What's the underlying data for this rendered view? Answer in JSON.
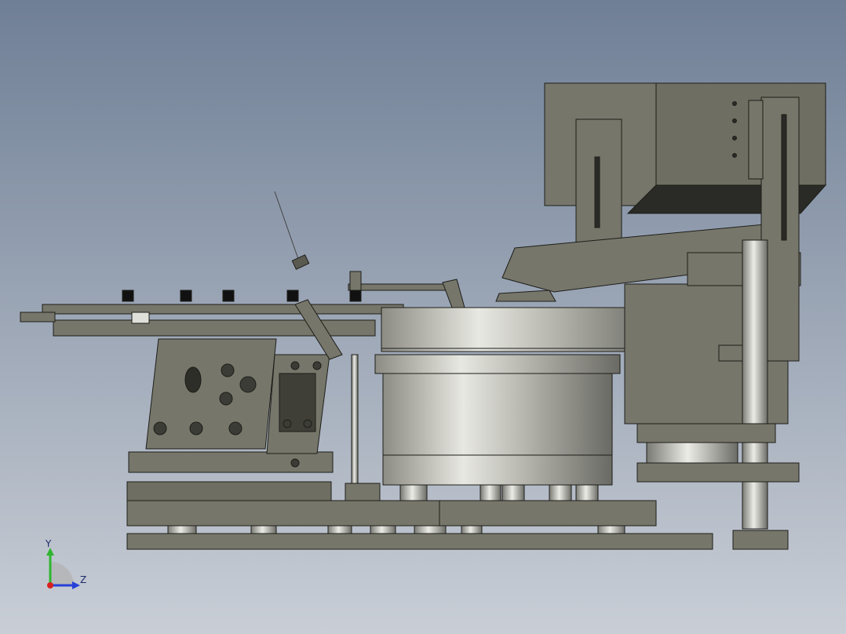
{
  "viewport": {
    "background_top": "#6f7f96",
    "background_bottom": "#c9ced6"
  },
  "model": {
    "part_color": "#76766a",
    "part_dark": "#4a4a42",
    "edge_color": "#1e1e1a"
  },
  "triad": {
    "y_label": "Y",
    "z_label": "Z",
    "y_color": "#2fb52f",
    "z_color": "#2840d8",
    "x_color": "#d82020"
  }
}
